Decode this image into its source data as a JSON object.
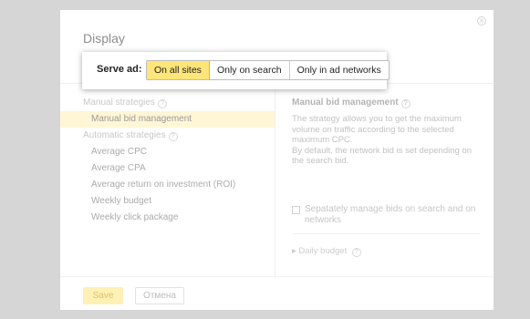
{
  "modal": {
    "title": "Display",
    "close_symbol": "×",
    "serve_ad": {
      "label": "Serve ad:",
      "options": [
        "On all sites",
        "Only on search",
        "Only in ad networks"
      ],
      "selected": "On all sites"
    },
    "strategies": {
      "manual_heading": "Manual strategies",
      "manual_items": [
        "Manual bid management"
      ],
      "automatic_heading": "Automatic strategies",
      "automatic_items": [
        "Average CPC",
        "Average CPA",
        "Average return on investment (ROI)",
        "Weekly budget",
        "Weekly click package"
      ],
      "help_symbol": "?"
    },
    "description": {
      "title": "Manual bid management",
      "paragraphs": [
        "The strategy allows you to get the maximum volume on traffic according to the selected maximum CPC.",
        "By default, the network bid is set depending on the search bid."
      ],
      "checkbox_label": "Sepatately manage bids on search and on networks",
      "daily_budget": "Daily budget"
    },
    "footer": {
      "save_label": "Save",
      "cancel_label": "Отмена"
    }
  },
  "colors": {
    "overlay": "#d6d6d6",
    "selected_segment": "#ffe57a",
    "selected_row": "#fff6d6",
    "save_button": "#fff1b5"
  }
}
